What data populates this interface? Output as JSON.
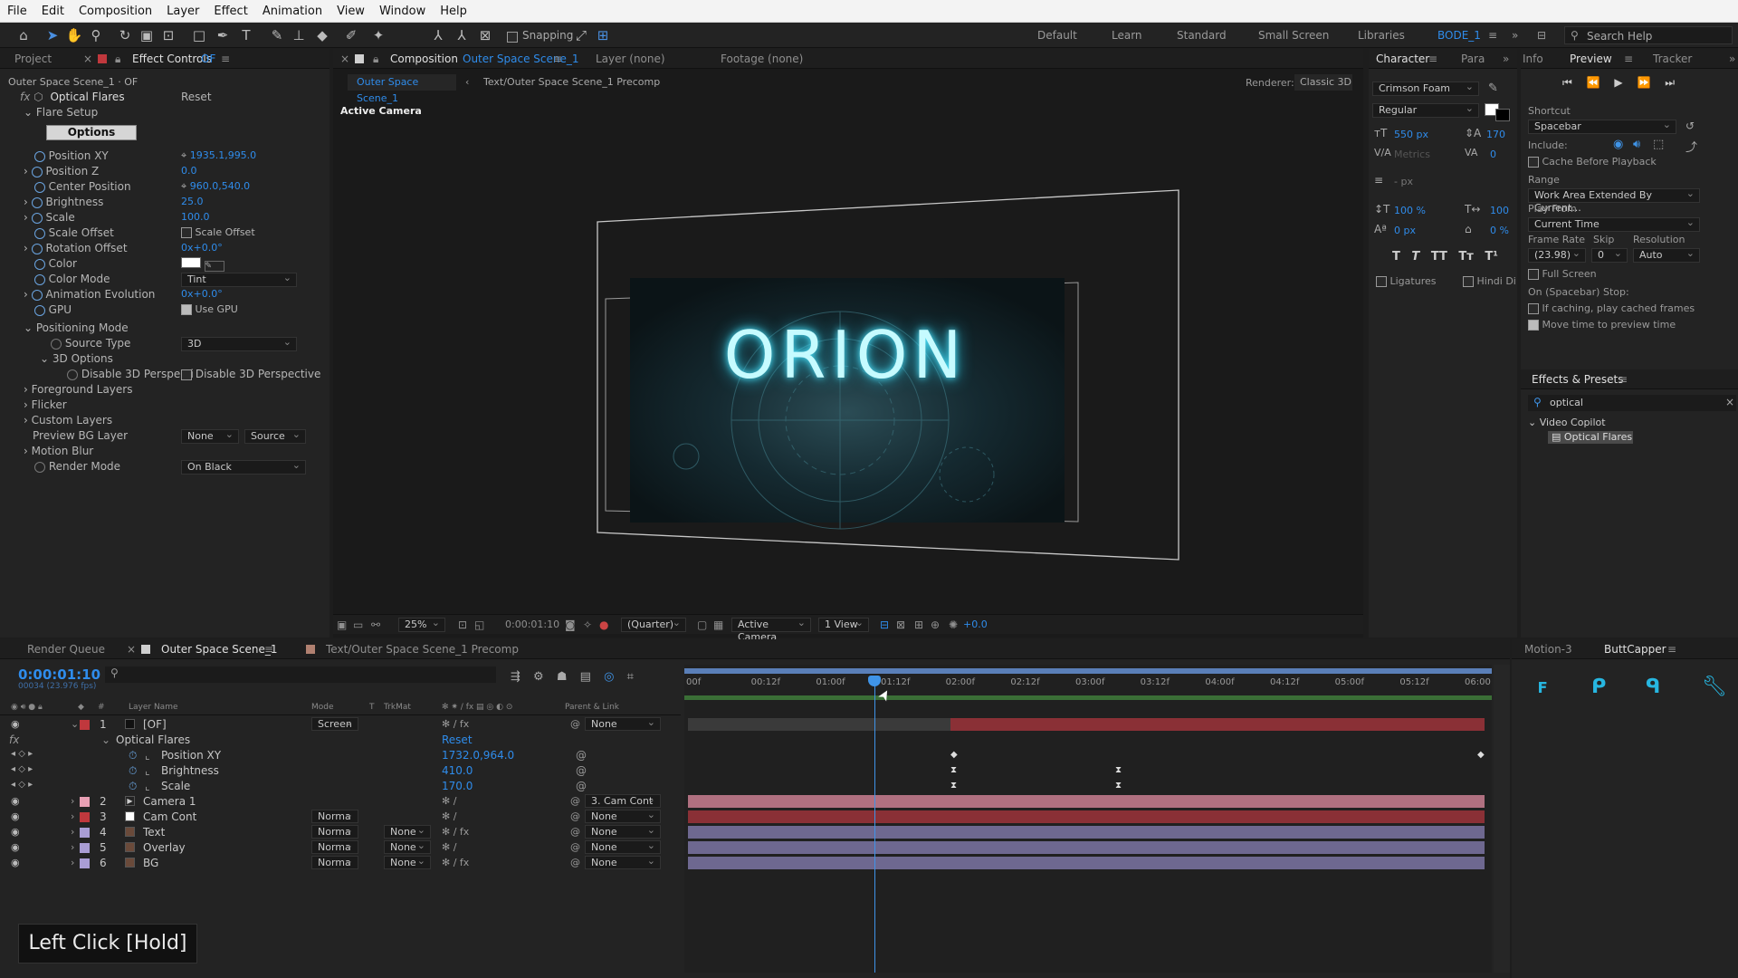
{
  "menu": [
    "File",
    "Edit",
    "Composition",
    "Layer",
    "Effect",
    "Animation",
    "View",
    "Window",
    "Help"
  ],
  "toolbar": {
    "snapping": "Snapping",
    "workspaces": [
      "Default",
      "Learn",
      "Standard",
      "Small Screen",
      "Libraries"
    ],
    "active_workspace": "BODE_1",
    "search_help": "Search Help"
  },
  "project_panel": {
    "tab_project": "Project",
    "tab_effect_controls": "Effect Controls",
    "effect_target": "OF",
    "header": "Outer Space Scene_1 · OF"
  },
  "effect_controls": {
    "effect_name": "Optical Flares",
    "reset": "Reset",
    "flare_setup": "Flare Setup",
    "options_button": "Options",
    "rows": [
      {
        "label": "Position XY",
        "value": "1935.1,995.0"
      },
      {
        "label": "Position Z",
        "value": "0.0"
      },
      {
        "label": "Center Position",
        "value": "960.0,540.0"
      },
      {
        "label": "Brightness",
        "value": "25.0"
      },
      {
        "label": "Scale",
        "value": "100.0"
      },
      {
        "label": "Scale Offset",
        "value": "Scale Offset"
      },
      {
        "label": "Rotation Offset",
        "value": "0x+0.0°"
      },
      {
        "label": "Color",
        "value": ""
      },
      {
        "label": "Color Mode",
        "value": "Tint"
      },
      {
        "label": "Animation Evolution",
        "value": "0x+0.0°"
      },
      {
        "label": "GPU",
        "value": "Use GPU"
      }
    ],
    "positioning_mode": "Positioning Mode",
    "source_type_label": "Source Type",
    "source_type": "3D",
    "options_3d": "3D Options",
    "disable_3d_label": "Disable 3D Perspecti",
    "disable_3d_value": "Disable 3D Perspective",
    "foreground_layers": "Foreground Layers",
    "flicker": "Flicker",
    "custom_layers": "Custom Layers",
    "preview_bg_label": "Preview BG Layer",
    "preview_bg_value": "None",
    "preview_bg_source": "Source",
    "motion_blur": "Motion Blur",
    "render_mode_label": "Render Mode",
    "render_mode": "On Black"
  },
  "composition": {
    "tab": "Composition",
    "comp_name": "Outer Space Scene_1",
    "layer_tab": "Layer (none)",
    "footage_tab": "Footage (none)",
    "breadcrumb_1": "Outer Space Scene_1",
    "breadcrumb_2": "Text/Outer Space Scene_1 Precomp",
    "renderer_label": "Renderer:",
    "renderer": "Classic 3D",
    "active_camera": "Active Camera",
    "orion": "ORION",
    "zoom": "25%",
    "timecode": "0:00:01:10",
    "resolution": "(Quarter)",
    "camera_view": "Active Camera",
    "views": "1 View",
    "exposure": "+0.0"
  },
  "character": {
    "tab": "Character",
    "tab2": "Para",
    "font": "Crimson Foam",
    "style": "Regular",
    "size": "550 px",
    "leading": "170",
    "tracking_label": "Metrics",
    "tracking_value": "0",
    "px_unit": "- px",
    "vscale": "100 %",
    "hscale": "100",
    "baseline": "0 px",
    "tsume": "0 %",
    "ligatures": "Ligatures",
    "hindi": "Hindi Di",
    "style_buttons": [
      "T",
      "T",
      "TT",
      "Tт",
      "T¹"
    ]
  },
  "preview": {
    "tab_info": "Info",
    "tab_preview": "Preview",
    "tab_tracker": "Tracker",
    "shortcut_label": "Shortcut",
    "shortcut": "Spacebar",
    "include_label": "Include:",
    "cache_before": "Cache Before Playback",
    "range_label": "Range",
    "range": "Work Area Extended By Current...",
    "play_from_label": "Play From",
    "play_from": "Current Time",
    "frame_rate_label": "Frame Rate",
    "skip_label": "Skip",
    "resolution_label": "Resolution",
    "frame_rate": "(23.98)",
    "skip": "0",
    "resolution": "Auto",
    "full_screen": "Full Screen",
    "on_stop_label": "On (Spacebar) Stop:",
    "if_caching": "If caching, play cached frames",
    "move_time": "Move time to preview time"
  },
  "effects_presets": {
    "tab": "Effects & Presets",
    "search": "optical",
    "category": "Video Copilot",
    "item": "Optical Flares"
  },
  "timeline": {
    "tab_render_queue": "Render Queue",
    "tab_comp": "Outer Space Scene_1",
    "tab_precomp": "Text/Outer Space Scene_1 Precomp",
    "timecode": "0:00:01:10",
    "frames_fps": "00034 (23.976 fps)",
    "ruler": [
      "00f",
      "00:12f",
      "01:00f",
      "01:12f",
      "02:00f",
      "02:12f",
      "03:00f",
      "03:12f",
      "04:00f",
      "04:12f",
      "05:00f",
      "05:12f",
      "06:00"
    ],
    "col_headers": {
      "layer_name": "Layer Name",
      "mode": "Mode",
      "t": "T",
      "trkmat": "TrkMat",
      "parent": "Parent & Link"
    },
    "layers": [
      {
        "num": "1",
        "name": "[OF]",
        "mode": "Screen",
        "trk": "",
        "parent": "None",
        "color": "#c0383d"
      },
      {
        "num": "2",
        "name": "Camera 1",
        "mode": "",
        "trk": "",
        "parent": "3. Cam Cont",
        "color": "#e8a0b4"
      },
      {
        "num": "3",
        "name": "Cam Cont",
        "mode": "Norma",
        "trk": "",
        "parent": "None",
        "color": "#c0383d"
      },
      {
        "num": "4",
        "name": "Text",
        "mode": "Norma",
        "trk": "None",
        "parent": "None",
        "color": "#a99dd4"
      },
      {
        "num": "5",
        "name": "Overlay",
        "mode": "Norma",
        "trk": "None",
        "parent": "None",
        "color": "#a99dd4"
      },
      {
        "num": "6",
        "name": "BG",
        "mode": "Norma",
        "trk": "None",
        "parent": "None",
        "color": "#a99dd4"
      }
    ],
    "effect_group": "Optical Flares",
    "effect_reset": "Reset",
    "props": [
      {
        "name": "Position XY",
        "value": "1732.0,964.0"
      },
      {
        "name": "Brightness",
        "value": "410.0"
      },
      {
        "name": "Scale",
        "value": "170.0"
      }
    ],
    "playhead_time": "01:12f"
  },
  "side_panel": {
    "tab_motion": "Motion-3",
    "tab_buttcapper": "ButtCapper"
  },
  "overlay_caption": "Left Click [Hold]"
}
